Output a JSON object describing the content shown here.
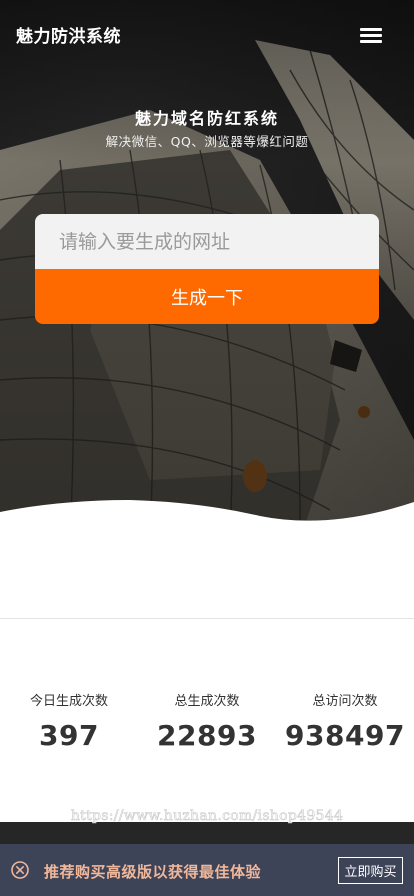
{
  "header": {
    "logo": "魅力防洪系统",
    "menu_icon": "hamburger-menu-icon"
  },
  "hero": {
    "title": "魅力域名防红系统",
    "subtitle": "解决微信、QQ、浏览器等爆红问题"
  },
  "form": {
    "url_placeholder": "请输入要生成的网址",
    "url_value": "",
    "generate_label": "生成一下",
    "accent_color": "#ff6a00"
  },
  "stats": [
    {
      "label": "今日生成次数",
      "value": "397"
    },
    {
      "label": "总生成次数",
      "value": "22893"
    },
    {
      "label": "总访问次数",
      "value": "938497"
    }
  ],
  "watermark": "https://www.huzhan.com/ishop49544",
  "promo": {
    "close_icon": "close-circle-icon",
    "text": "推荐购买高级版以获得最佳体验",
    "buy_label": "立即购买"
  }
}
